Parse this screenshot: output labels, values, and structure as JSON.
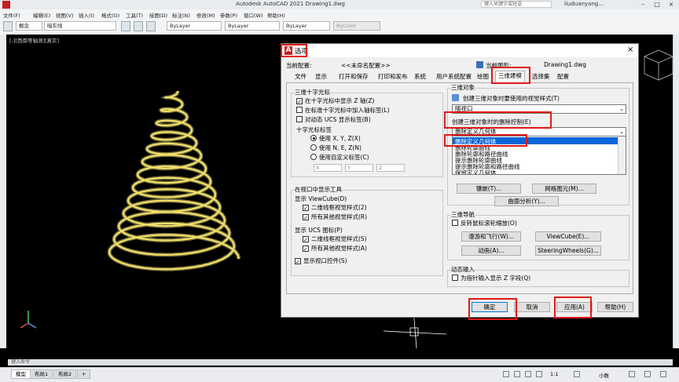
{
  "app": {
    "title": "Autodesk AutoCAD 2021    Drawing1.dwg",
    "search_placeholder": "键入关键字或短语",
    "user": "liuduanyang...",
    "menu": [
      "文件(F)",
      "编辑(E)",
      "视图(V)",
      "插入(I)",
      "格式(O)",
      "工具(T)",
      "绘图(D)",
      "标注(N)",
      "修改(M)",
      "参数(P)",
      "窗口(W)",
      "帮助(H)"
    ],
    "ribbon": {
      "visual_style": "概念",
      "linetype_combo": "暗实线",
      "layer1": "ByLayer",
      "layer2": "ByLayer",
      "layer3": "ByLayer",
      "color_combo": "ByColor"
    },
    "viewport_label": "[-][西南等轴测][真实]",
    "command_line": "键入命令",
    "layout_tabs": [
      "模型",
      "布局1",
      "布局2",
      "+"
    ],
    "status_scale": "1:1",
    "status_units": "小数"
  },
  "dialog": {
    "title": "选项",
    "close": "×",
    "current_profile_label": "当前配置:",
    "current_profile_value": "<<未命名配置>>",
    "current_drawing_label": "当前图形:",
    "current_drawing_value": "Drawing1.dwg",
    "tabs": [
      "文件",
      "显示",
      "打开和保存",
      "打印和发布",
      "系统",
      "用户系统配置",
      "绘图",
      "三维建模",
      "选择集",
      "配置"
    ],
    "active_tab": "三维建模",
    "crosshair": {
      "title": "三维十字光标",
      "cb1": "在十字光标中显示 Z 轴(Z)",
      "cb2": "在标准十字光标中加入轴标签(L)",
      "cb3": "对动态 UCS 显示标签(B)",
      "labels_title": "十字光标标签",
      "r1": "使用 X, Y, Z(X)",
      "r2": "使用 N, E, Z(N)",
      "r3": "使用自定义标签(C)",
      "in_x": "X",
      "in_y": "Y",
      "in_z": "Z"
    },
    "viewport_tools": {
      "title": "在视口中显示工具",
      "viewcube_title": "显示 ViewCube(D)",
      "vc1": "二维线框视觉样式(2)",
      "vc2": "所有其他视觉样式(R)",
      "ucs_title": "显示 UCS 图标(P)",
      "ucs1": "二维线框视觉样式(S)",
      "ucs2": "所有其他视觉样式(A)",
      "vp_controls": "显示视口控件(S)"
    },
    "objects3d": {
      "title": "三维对象",
      "style_label": "创建三维对象时要使用的视觉样式(T)",
      "style_value": "随视口",
      "deletion_label": "创建三维对象时的删除控制(E)",
      "deletion_value": "删除定义几何体",
      "list_items": [
        "删除定义几何体",
        "删除轮廓曲线",
        "删除轮廓和路径曲线",
        "提示删除轮廓曲线",
        "提示删除轮廓和路径曲线",
        "保留定义几何体"
      ],
      "btn_isolines": "镶嵌(T)...",
      "btn_mesh": "网格图元(M)...",
      "btn_surface": "曲面分析(Y)..."
    },
    "nav3d": {
      "title": "三维导航",
      "cb_reverse": "反转鼠标滚轮缩放(O)",
      "btn_walk": "漫游和飞行(W)...",
      "btn_viewcube": "ViewCube(E)...",
      "btn_anim": "动画(A)...",
      "btn_steering": "SteeringWheels(G)..."
    },
    "dynamic_input": {
      "title": "动态输入",
      "cb": "为指针输入显示 Z 字段(Q)"
    },
    "buttons": {
      "ok": "确定",
      "cancel": "取消",
      "apply": "应用(A)",
      "help": "帮助(H)"
    }
  },
  "colors": {
    "highlight_red": "#e01818",
    "selection_blue": "#0a66d8",
    "spring_yellow": "#f3e06a"
  }
}
